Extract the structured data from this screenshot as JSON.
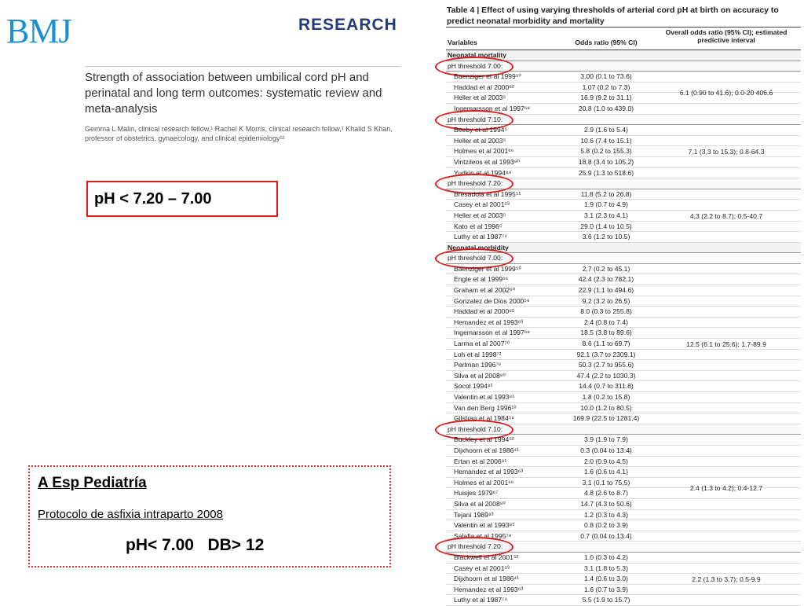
{
  "header": {
    "logo": "BMJ",
    "section": "RESEARCH",
    "title": "Strength of association between umbilical cord pH and perinatal and long term outcomes: systematic review and meta-analysis",
    "authors": "Gemma L Malin, clinical research fellow,¹ Rachel K Morris, clinical research fellow,¹ Khalid S Khan, professor of obstetrics, gynaecology, and clinical epidemiology¹²"
  },
  "ph_box": "pH < 7.20 – 7.00",
  "note_box": {
    "journal": "A Esp Pediatría",
    "protocol": "Protocolo de asfixia intraparto  2008",
    "criteria": "pH< 7.00   DB> 12"
  },
  "table": {
    "title": "Table 4 | Effect of using varying thresholds of arterial cord pH at birth on accuracy to predict neonatal morbidity and mortality",
    "headers": {
      "variables": "Variables",
      "odds_ratio": "Odds ratio (95% CI)",
      "overall": "Overall odds ratio (95% CI); estimated predictive interval"
    },
    "sections": [
      {
        "label": "Neonatal mortality",
        "groups": [
          {
            "threshold": "pH threshold 7.00:",
            "overall": "6.1 (0.90 to 41.6); 0.0-20 406.6",
            "rows": [
              {
                "study": "Baenziger et al 1999⁵⁰",
                "or": "3.00 (0.1 to 73.6)"
              },
              {
                "study": "Haddad et al 2000⁶²",
                "or": "1.07 (0.2 to 7.3)"
              },
              {
                "study": "Heller et al 2003⁵",
                "or": "16.9 (9.2 to 31.1)"
              },
              {
                "study": "Ingemarsson et al 1997⁶⁸",
                "or": "20.8 (1.0 to 439.0)"
              }
            ]
          },
          {
            "threshold": "pH threshold 7.10:",
            "overall": "7.1 (3.3 to 15.3); 0.8-64.3",
            "rows": [
              {
                "study": "Beeby et al 1994⁵",
                "or": "2.9 (1.6 to 5.4)"
              },
              {
                "study": "Heller et al 2003⁵",
                "or": "10.6 (7.4 to 15.1)"
              },
              {
                "study": "Holmes et al 2001⁶⁶",
                "or": "5.8 (0.2 to 155.3)"
              },
              {
                "study": "Vintzileos et al 1993⁹⁰",
                "or": "18.8 (3.4 to 105.2)"
              },
              {
                "study": "Yudkin et al 1994⁸⁹",
                "or": "25.9 (1.3 to 518.6)"
              }
            ]
          },
          {
            "threshold": "pH threshold 7.20:",
            "overall": "4.3 (2.2 to 8.7); 0.5-40.7",
            "rows": [
              {
                "study": "Bresadola et al 1995⁵¹",
                "or": "11.8 (5.2 to 26.8)"
              },
              {
                "study": "Casey et al 2001⁵³",
                "or": "1.9 (0.7 to 4.9)"
              },
              {
                "study": "Heller et al 2003⁵",
                "or": "3.1 (2.3 to 4.1)"
              },
              {
                "study": "Kato et al 1996⁵",
                "or": "29.0 (1.4 to 10.5)"
              },
              {
                "study": "Luthy et al 1987⁷⁴",
                "or": "3.6 (1.2 to 10.5)"
              }
            ]
          }
        ]
      },
      {
        "label": "Neonatal morbidity",
        "groups": [
          {
            "threshold": "pH threshold 7.00:",
            "overall": "12.5 (6.1 to 25.6); 1.7-89.9",
            "rows": [
              {
                "study": "Baenziger et al 1999⁵⁰",
                "or": "2.7 (0.2 to 45.1)"
              },
              {
                "study": "Engle et al 1999⁵⁶",
                "or": "42.4 (2.3 to 782.1)"
              },
              {
                "study": "Graham et al 2002⁶⁰",
                "or": "22.9 (1.1 to 494.6)"
              },
              {
                "study": "Gonzalez de Dios 2000⁵⁹",
                "or": "9.2 (3.2 to 26.5)"
              },
              {
                "study": "Haddad et al 2000⁶²",
                "or": "8.0 (0.3 to 255.8)"
              },
              {
                "study": "Hemandez et al 1993⁶³",
                "or": "2.4 (0.8 to 7.4)"
              },
              {
                "study": "Ingemarsson et al 1997⁶⁸",
                "or": "18.5 (3.8 to 89.6)"
              },
              {
                "study": "Larma et al 2007⁷⁰",
                "or": "8.6 (1.1 to 69.7)"
              },
              {
                "study": "Loh et al 1998⁷²",
                "or": "92.1 (3.7 to 2309.1)"
              },
              {
                "study": "Perlman 1996⁷⁶",
                "or": "50.3 (2.7 to 955.6)"
              },
              {
                "study": "Silva et al 2008⁸⁰",
                "or": "47.4 (2.2 to 1030.3)"
              },
              {
                "study": "Socol 1994⁸¹",
                "or": "14.4 (0.7 to 311.8)"
              },
              {
                "study": "Valentin et al 1993⁸⁵",
                "or": "1.8 (0.2 to 15.8)"
              },
              {
                "study": "Van den Berg 1996¹⁰",
                "or": "10.0 (1.2 to 80.5)"
              },
              {
                "study": "Gilstrap et al 1984⁵⁸",
                "or": "169.9 (22.5 to 1281.4)"
              }
            ]
          },
          {
            "threshold": "pH threshold 7.10:",
            "overall": "2.4 (1.3 to 4.2); 0.4-12.7",
            "rows": [
              {
                "study": "Buckley et al 1994⁵²",
                "or": "3.9 (1.9 to 7.9)"
              },
              {
                "study": "Dijxhoorn et al 1986⁴¹",
                "or": "0.3 (0.04 to 13.4)"
              },
              {
                "study": "Ertan et al 2006⁹¹",
                "or": "2.0 (0.9 to 4.5)"
              },
              {
                "study": "Hemandez et al 1993⁶³",
                "or": "1.6 (0.6 to 4.1)"
              },
              {
                "study": "Holmes et al 2001⁶⁶",
                "or": "3.1 (0.1 to 75.5)"
              },
              {
                "study": "Huisjes 1979⁶⁷",
                "or": "4.8 (2.6 to 8.7)"
              },
              {
                "study": "Silva et al 2008⁸⁰",
                "or": "14.7 (4.3 to 50.6)"
              },
              {
                "study": "Tejani 1989⁸³",
                "or": "1.2 (0.3 to 4.3)"
              },
              {
                "study": "Valentin et al 1993⁸⁵",
                "or": "0.8 (0.2 to 3.9)"
              },
              {
                "study": "Salafia et al 1995⁷⁹",
                "or": "0.7 (0.04 to 13.4)"
              }
            ]
          },
          {
            "threshold": "pH threshold 7.20:",
            "overall": "2.2 (1.3 to 3.7); 0.5-9.9",
            "rows": [
              {
                "study": "Blackwell et al 2001⁵²",
                "or": "1.0 (0.3 to 4.2)"
              },
              {
                "study": "Casey et al 2001⁵³",
                "or": "3.1 (1.8 to 5.3)"
              },
              {
                "study": "Dijxhoorn et al 1986⁴¹",
                "or": "1.4 (0.6 to 3.0)"
              },
              {
                "study": "Hemandez et al 1993⁶³",
                "or": "1.6 (0.7 to 3.9)"
              },
              {
                "study": "Luthy et al 1987⁷⁴",
                "or": "5.5 (1.9 to 15.7)"
              }
            ]
          }
        ]
      }
    ]
  }
}
